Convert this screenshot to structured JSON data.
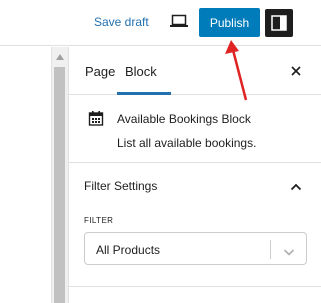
{
  "topbar": {
    "save_draft": "Save draft",
    "preview_icon": "desktop-preview-icon",
    "publish": "Publish",
    "settings_icon": "sidebar-toggle-icon"
  },
  "sidebar": {
    "tabs": [
      {
        "label": "Page"
      },
      {
        "label": "Block",
        "active": true
      }
    ],
    "close_icon": "close-icon",
    "block": {
      "icon": "calendar-icon",
      "title": "Available Bookings Block",
      "description": "List all available bookings."
    },
    "panel": {
      "title": "Filter Settings",
      "chevron_icon": "chevron-up-icon",
      "field_label": "FILTER",
      "select_value": "All Products",
      "select_icon": "chevron-down-icon"
    }
  },
  "colors": {
    "accent": "#007cba",
    "link": "#2271b1",
    "annotation": "#e02424"
  }
}
